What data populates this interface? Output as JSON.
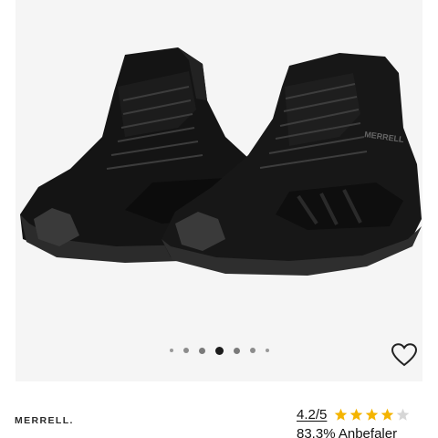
{
  "product": {
    "brand": "MERRELL.",
    "image_alt": "Black Merrell hiking boots pair",
    "boot_logo_text": "MERRELL"
  },
  "gallery": {
    "dot_count": 7,
    "active_index": 3
  },
  "rating": {
    "score": "4.2/5",
    "stars_filled": 4,
    "stars_total": 5,
    "recommend_text": "83.3% Anbefaler"
  },
  "colors": {
    "gallery_bg": "#f5f5f5",
    "star": "#f4b400",
    "star_empty": "#d6d6d6",
    "boot": "#121212"
  },
  "icons": {
    "wishlist": "heart-outline-icon",
    "star": "star-icon"
  }
}
